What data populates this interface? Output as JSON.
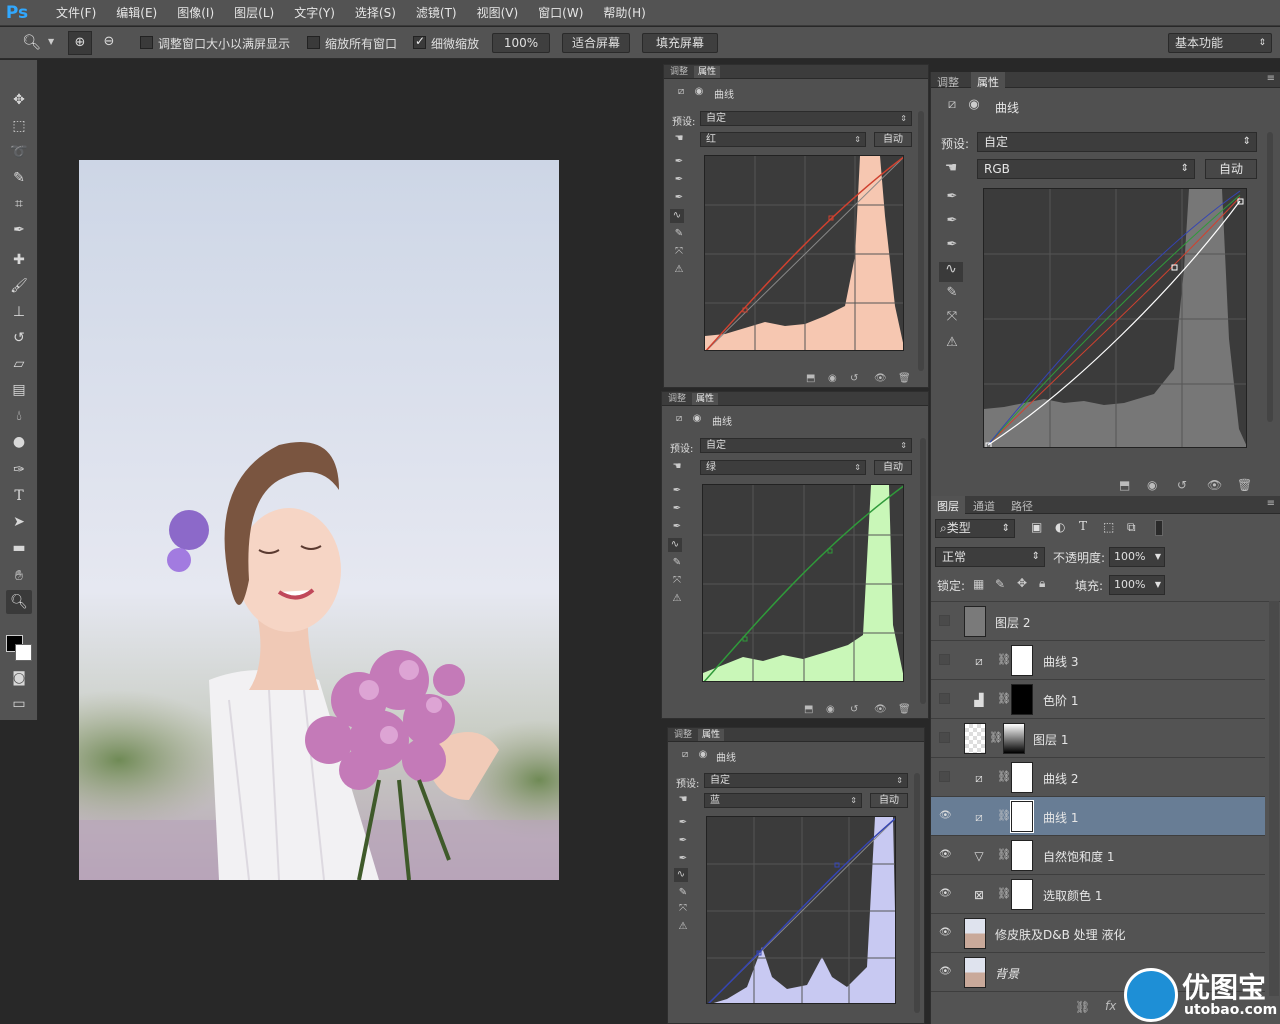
{
  "app": {
    "logo": "Ps"
  },
  "menu": [
    "文件(F)",
    "编辑(E)",
    "图像(I)",
    "图层(L)",
    "文字(Y)",
    "选择(S)",
    "滤镜(T)",
    "视图(V)",
    "窗口(W)",
    "帮助(H)"
  ],
  "options": {
    "resize_windows": "调整窗口大小以满屏显示",
    "zoom_all": "缩放所有窗口",
    "scrubby_zoom": "细微缩放",
    "zoom_value": "100%",
    "fit_screen": "适合屏幕",
    "fill_screen": "填充屏幕",
    "workspace": "基本功能"
  },
  "curves_panel": {
    "tab_adjust": "调整",
    "tab_props": "属性",
    "title": "曲线",
    "preset_label": "预设:",
    "preset_value": "自定",
    "auto": "自动"
  },
  "panels": [
    {
      "channel": "红",
      "color": "#f6c7b1",
      "line": "#d0412f"
    },
    {
      "channel": "绿",
      "color": "#c9f7b8",
      "line": "#2f9a3a"
    },
    {
      "channel": "蓝",
      "color": "#c8c9f2",
      "line": "#3444b4"
    }
  ],
  "big_panel": {
    "channel": "RGB"
  },
  "layers_panel": {
    "tab_layers": "图层",
    "tab_channels": "通道",
    "tab_paths": "路径",
    "kind": "类型",
    "blend_mode": "正常",
    "opacity_label": "不透明度:",
    "opacity_value": "100%",
    "lock_label": "锁定:",
    "fill_label": "填充:",
    "fill_value": "100%",
    "layers": [
      {
        "name": "图层 2",
        "visible": false,
        "type": "pixel"
      },
      {
        "name": "曲线 3",
        "visible": false,
        "type": "curves"
      },
      {
        "name": "色阶 1",
        "visible": false,
        "type": "levels"
      },
      {
        "name": "图层 1",
        "visible": false,
        "type": "gradient"
      },
      {
        "name": "曲线 2",
        "visible": false,
        "type": "curves"
      },
      {
        "name": "曲线 1",
        "visible": true,
        "type": "curves",
        "selected": true
      },
      {
        "name": "自然饱和度 1",
        "visible": true,
        "type": "vibrance"
      },
      {
        "name": "选取颜色 1",
        "visible": true,
        "type": "selective"
      },
      {
        "name": "修皮肤及D&B 处理 液化",
        "visible": true,
        "type": "photo"
      },
      {
        "name": "背景",
        "visible": true,
        "type": "photo"
      }
    ]
  },
  "watermark": {
    "brand": "优图宝",
    "url": "utobao.com"
  }
}
